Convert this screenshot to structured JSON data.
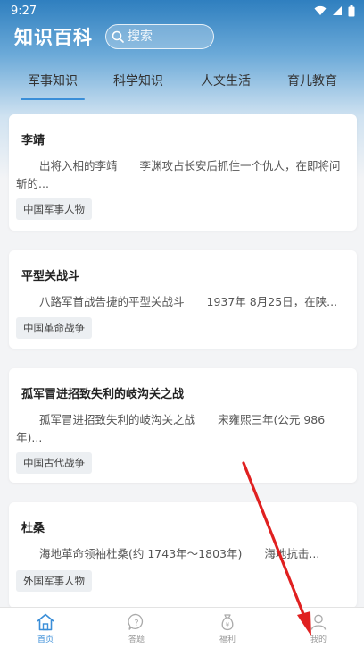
{
  "status_bar": {
    "time": "9:27"
  },
  "header": {
    "title": "知识百科",
    "search_placeholder": "搜索"
  },
  "tabs": [
    {
      "label": "军事知识",
      "active": true
    },
    {
      "label": "科学知识",
      "active": false
    },
    {
      "label": "人文生活",
      "active": false
    },
    {
      "label": "育儿教育",
      "active": false
    }
  ],
  "cards": [
    {
      "title": "李靖",
      "summary": "出将入相的李靖　　李渊攻占长安后抓住一个仇人，在即将问斩的...",
      "tag": "中国军事人物"
    },
    {
      "title": "平型关战斗",
      "summary": "八路军首战告捷的平型关战斗　　1937年 8月25日，在陕...",
      "tag": "中国革命战争"
    },
    {
      "title": "孤军冒进招致失利的岐沟关之战",
      "summary": "孤军冒进招致失利的岐沟关之战　　宋雍熙三年(公元 986年)...",
      "tag": "中国古代战争"
    },
    {
      "title": "杜桑",
      "summary": "海地革命领袖杜桑(约 1743年～1803年)　　海地抗击...",
      "tag": "外国军事人物"
    }
  ],
  "bottom_nav": [
    {
      "label": "首页",
      "icon": "home-icon",
      "active": true
    },
    {
      "label": "答题",
      "icon": "question-icon",
      "active": false
    },
    {
      "label": "福利",
      "icon": "money-bag-icon",
      "active": false
    },
    {
      "label": "我的",
      "icon": "user-icon",
      "active": false
    }
  ],
  "colors": {
    "accent": "#3a8ed8",
    "annotation_arrow": "#e02020"
  }
}
